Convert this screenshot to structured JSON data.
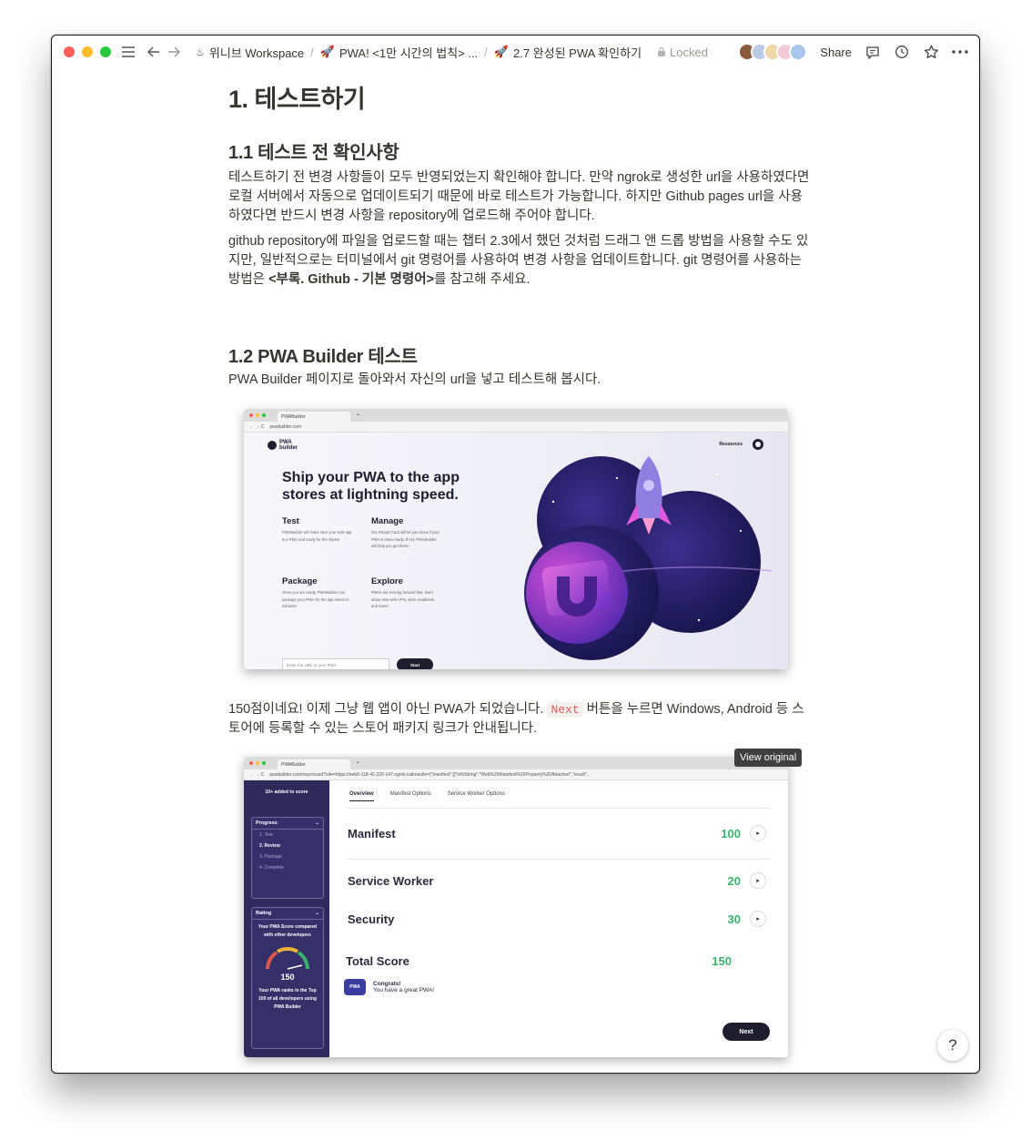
{
  "topbar": {
    "breadcrumbs": [
      {
        "icon": "workspace-icon",
        "label": "위니브 Workspace"
      },
      {
        "icon": "rocket-emoji",
        "label": "PWA! <1만 시간의 법칙> ..."
      },
      {
        "icon": "rocket-emoji",
        "label": "2.7 완성된 PWA 확인하기"
      }
    ],
    "locked_label": "Locked",
    "share_label": "Share"
  },
  "content": {
    "h1": "1. 테스트하기",
    "s1_title": "1.1 테스트 전 확인사항",
    "s1_p1": "테스트하기 전 변경 사항들이 모두 반영되었는지 확인해야 합니다. 만약 ngrok로 생성한 url을 사용하였다면 로컬 서버에서 자동으로 업데이트되기 때문에 바로 테스트가 가능합니다. 하지만 Github pages url을 사용하였다면 반드시 변경 사항을 repository에 업로드해 주어야 합니다.",
    "s1_p2_a": "github repository에 파일을 업로드할 때는 챕터 2.3에서 했던 것처럼 드래그 앤 드롭 방법을 사용할 수도 있지만, 일반적으로는 터미널에서 git 명령어를 사용하여 변경 사항을 업데이트합니다. git 명령어를 사용하는 방법은 ",
    "s1_p2_bold": "<부록. Github - 기본 명령어>",
    "s1_p2_b": "를 참고해 주세요.",
    "s2_title": "1.2 PWA Builder 테스트",
    "s2_p1": "PWA Builder 페이지로 돌아와서 자신의 url을 넣고 테스트해 봅시다.",
    "s2_p2_a": "150점이네요! 이제 그냥 웹 앱이 아닌 PWA가 되었습니다. ",
    "s2_p2_code": "Next",
    "s2_p2_b": " 버튼을 누르면 Windows, Android 등 스토어에 등록할 수 있는 스토어 패키지 링크가 안내됩니다."
  },
  "shot1": {
    "tab_label": "PWABuilder",
    "url": "pwabuilder.com",
    "logo": "PWA builder",
    "nav_resources": "Resources",
    "hero_title": "Ship your PWA to the app stores at lightning speed.",
    "features": [
      {
        "title": "Test",
        "desc": "PWABuilder will make sure your web app is a PWA and ready for the stores!"
      },
      {
        "title": "Manage",
        "desc": "Our Report Card will let you know if your PWA is store-ready. If not, PWABuilder will help you get there!"
      },
      {
        "title": "Package",
        "desc": "Once you are ready, PWABuilder can package your PWA for the app stores in minutes!"
      },
      {
        "title": "Explore",
        "desc": "PWAs are moving forward fast, learn about new web APIs, store readiness, and more!"
      }
    ],
    "input_placeholder": "Enter the URL to your PWA",
    "start_label": "Start"
  },
  "shot2": {
    "tab_label": "PWABuilder",
    "url": "pwabuilder.com/reportcard?site=https://eeb0-118-42-233-147.ngrok.io&results={\"manifest\":[{\"infoString\":\"Web%20Manifest%20Properly%20Attached\",\"result\"...",
    "added_to_score": "10+ added to score",
    "progress_title": "Progress",
    "progress_items": [
      "1. Test",
      "2. Review",
      "3. Package",
      "4. Complete"
    ],
    "rating_title": "Rating",
    "rating_text": "Your PWA Score compared with other developers",
    "rating_score": "150",
    "rank_text": "Your PWA ranks in the Top 100 of all developers using PWA Builder",
    "tabs": [
      "Overview",
      "Manifest Options",
      "Service Worker Options"
    ],
    "rows": [
      {
        "label": "Manifest",
        "score": "100"
      },
      {
        "label": "Service Worker",
        "score": "20"
      },
      {
        "label": "Security",
        "score": "30"
      }
    ],
    "total_label": "Total Score",
    "total_score": "150",
    "congrats_title": "Congrats!",
    "congrats_text": "You have a great PWA!",
    "next_label": "Next",
    "view_original": "View original"
  },
  "help_label": "?",
  "colors": {
    "accent_green": "#3ab26c",
    "pwa_navy": "#2e2a5c",
    "code_red": "#eb5757"
  }
}
